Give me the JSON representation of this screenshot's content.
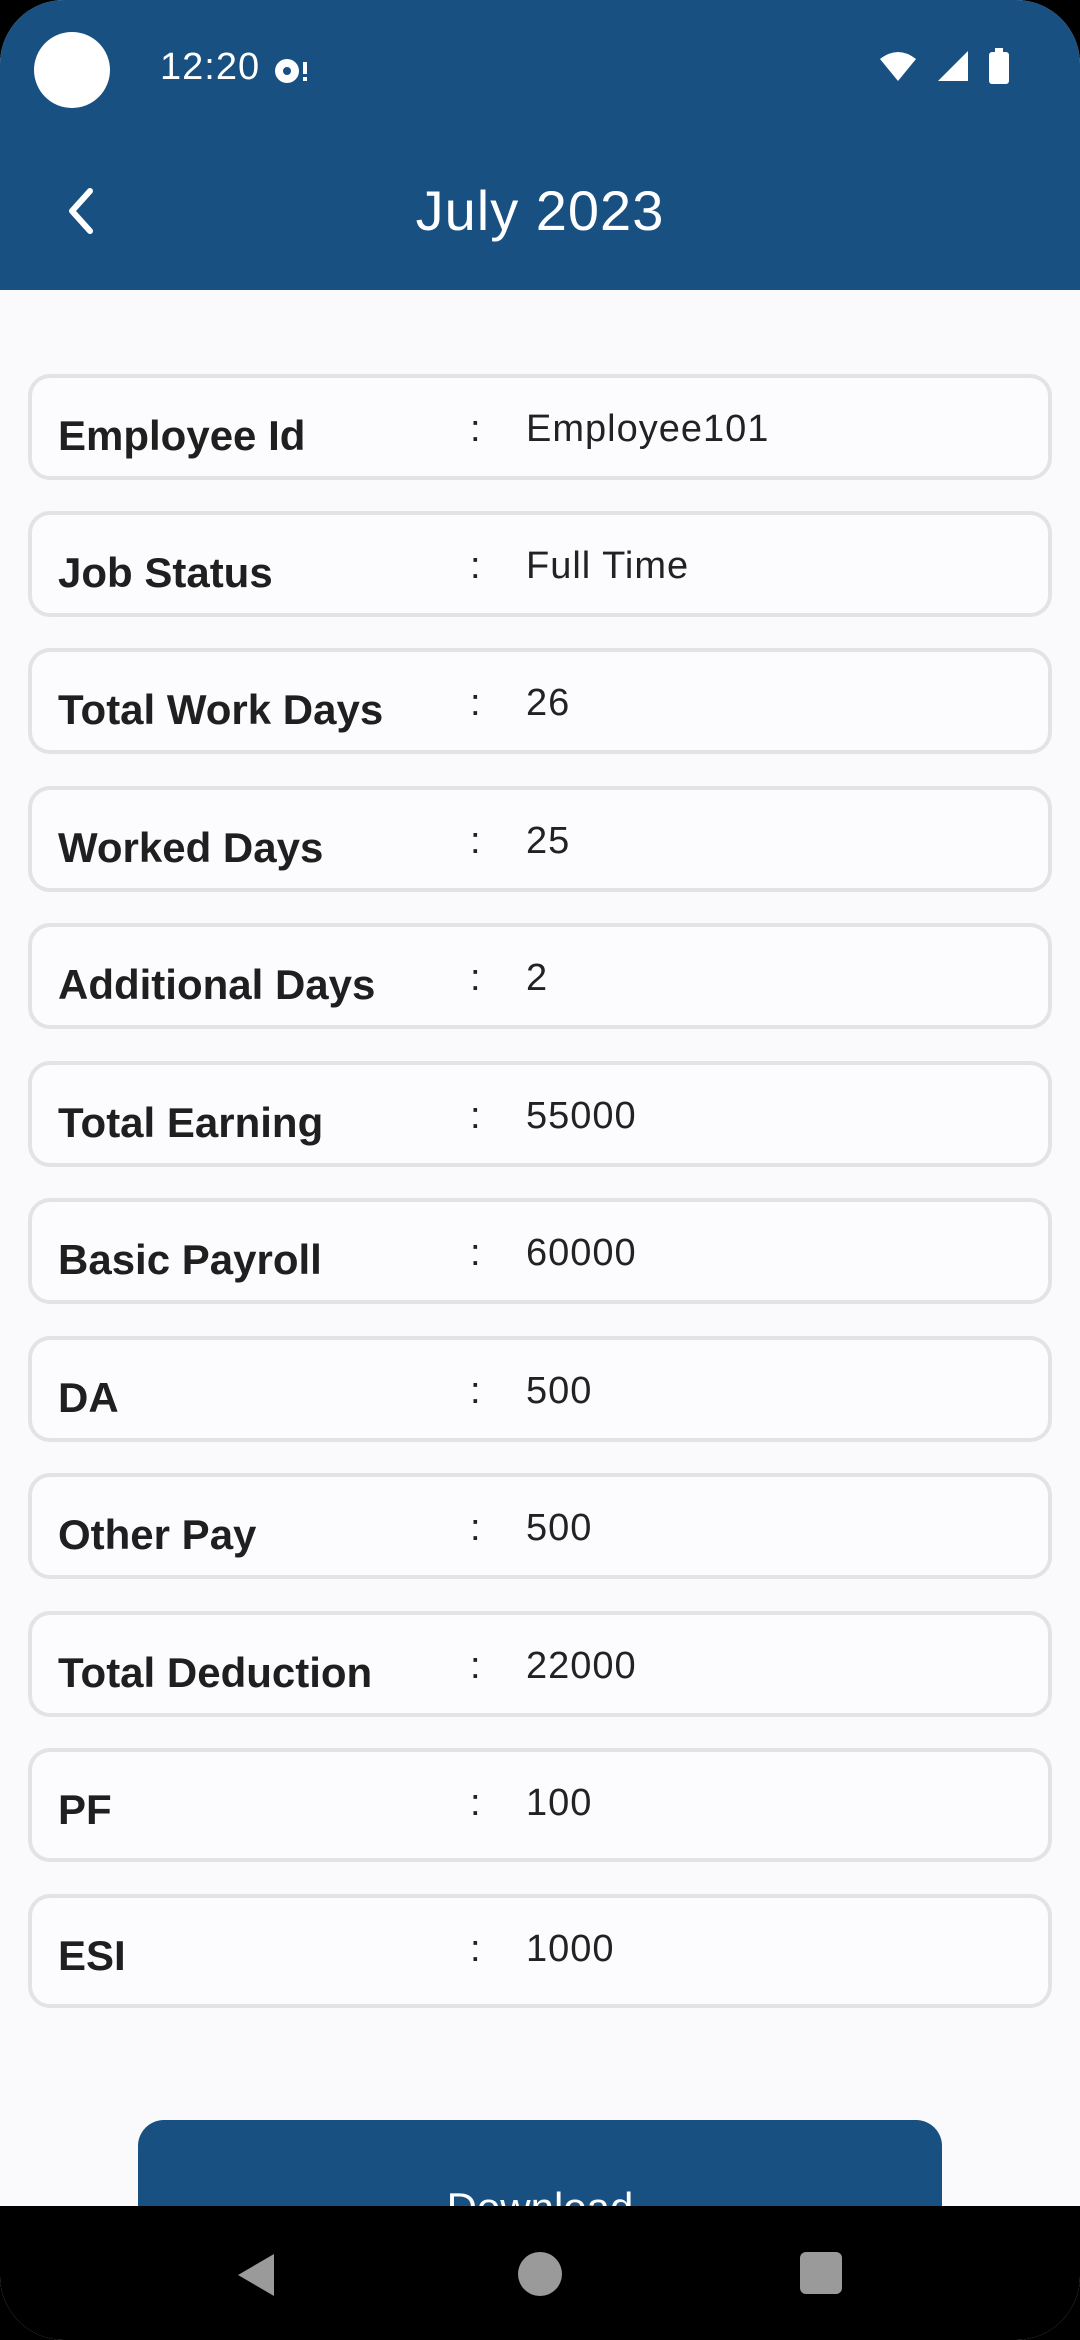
{
  "status_bar": {
    "time": "12:20"
  },
  "app_bar": {
    "title": "July 2023"
  },
  "colors": {
    "primary": "#175081",
    "background": "#fafafc",
    "row_border": "#e3e3e6"
  },
  "separator": ":",
  "rows": [
    {
      "label": "Employee Id",
      "value": "Employee101"
    },
    {
      "label": "Job Status",
      "value": "Full Time"
    },
    {
      "label": "Total Work Days",
      "value": "26"
    },
    {
      "label": "Worked Days",
      "value": "25"
    },
    {
      "label": "Additional Days",
      "value": "2"
    },
    {
      "label": "Total Earning",
      "value": "55000"
    },
    {
      "label": "Basic Payroll",
      "value": "60000"
    },
    {
      "label": "DA",
      "value": "500"
    },
    {
      "label": "Other Pay",
      "value": "500"
    },
    {
      "label": "Total Deduction",
      "value": "22000"
    },
    {
      "label": "PF",
      "value": "100"
    },
    {
      "label": "ESI",
      "value": "1000"
    }
  ],
  "download_button": {
    "label": "Download"
  }
}
